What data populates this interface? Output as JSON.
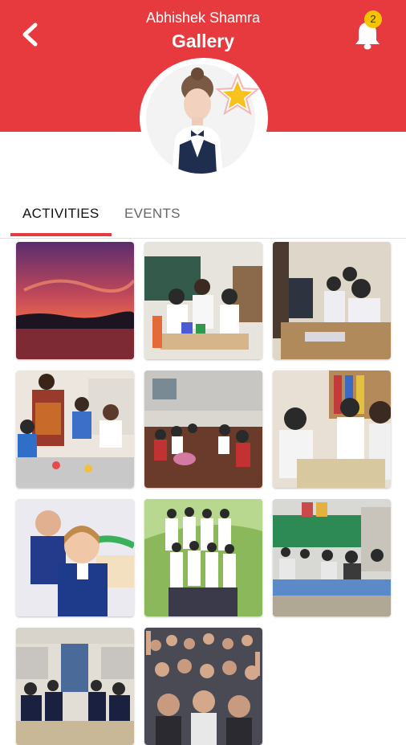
{
  "header": {
    "user_name": "Abhishek Shamra",
    "title": "Gallery",
    "notification_count": "2",
    "accent_color": "#e63a3f",
    "badge_color": "#f5c400",
    "back_icon": "back-arrow-icon",
    "bell_icon": "bell-icon",
    "profile_star_icon": "star-icon"
  },
  "tabs": [
    {
      "label": "ACTIVITIES",
      "selected": true
    },
    {
      "label": "EVENTS",
      "selected": false
    }
  ],
  "gallery": {
    "images": [
      {
        "subject": "sunset-over-water"
      },
      {
        "subject": "children-at-table-with-toys"
      },
      {
        "subject": "students-at-computers"
      },
      {
        "subject": "teacher-with-children-crafting"
      },
      {
        "subject": "classroom-children-at-desks"
      },
      {
        "subject": "students-writing-in-class"
      },
      {
        "subject": "smiling-children-in-uniform"
      },
      {
        "subject": "group-of-students-in-white-uniforms"
      },
      {
        "subject": "green-wall-classroom"
      },
      {
        "subject": "students-in-hall"
      },
      {
        "subject": "crowd-of-students"
      }
    ]
  }
}
